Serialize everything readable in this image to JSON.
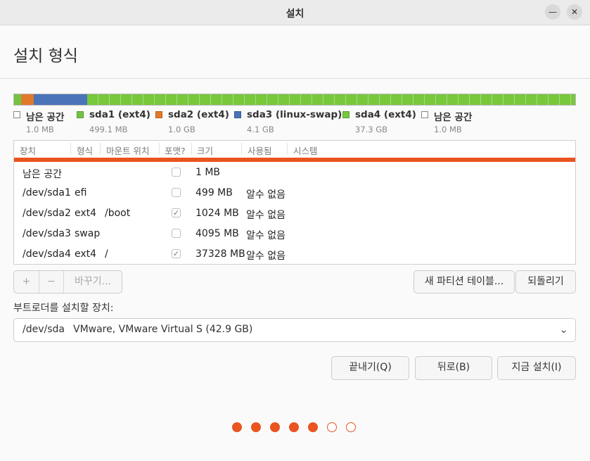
{
  "window": {
    "title": "설치",
    "min_glyph": "—",
    "close_glyph": "✕"
  },
  "page": {
    "heading": "설치 형식"
  },
  "disk_bar": {
    "segments": [
      {
        "name": "남은 공간",
        "share": 0.0002,
        "kind": "free"
      },
      {
        "name": "sda1 (ext4)",
        "share": 0.012,
        "kind": "p1"
      },
      {
        "name": "sda2 (ext4)",
        "share": 0.023,
        "kind": "p2"
      },
      {
        "name": "sda3 (linux-swap)",
        "share": 0.095,
        "kind": "p3"
      },
      {
        "name": "sda4 (ext4)",
        "share": 0.87,
        "kind": "p4"
      }
    ]
  },
  "legend": [
    {
      "name": "남은 공간",
      "size": "1.0 MB",
      "color": "#ffffff"
    },
    {
      "name": "sda1 (ext4)",
      "size": "499.1 MB",
      "color": "#73c244"
    },
    {
      "name": "sda2 (ext4)",
      "size": "1.0 GB",
      "color": "#e07a2a"
    },
    {
      "name": "sda3 (linux-swap)",
      "size": "4.1 GB",
      "color": "#4a73b8"
    },
    {
      "name": "sda4 (ext4)",
      "size": "37.3 GB",
      "color": "#78c83c"
    },
    {
      "name": "남은 공간",
      "size": "1.0 MB",
      "color": "#ffffff"
    }
  ],
  "table": {
    "headers": {
      "device": "장치",
      "type": "형식",
      "mount": "마운트 위치",
      "format": "포맷?",
      "size": "크기",
      "used": "사용됨",
      "system": "시스템"
    },
    "rows": [
      {
        "device": "남은 공간",
        "type": "",
        "mount": "",
        "format": false,
        "size": "1 MB",
        "used": ""
      },
      {
        "device": "/dev/sda1",
        "type": "efi",
        "mount": "",
        "format": false,
        "size": "499 MB",
        "used": "알수 없음"
      },
      {
        "device": "/dev/sda2",
        "type": "ext4",
        "mount": "/boot",
        "format": true,
        "size": "1024 MB",
        "used": "알수 없음"
      },
      {
        "device": "/dev/sda3",
        "type": "swap",
        "mount": "",
        "format": false,
        "size": "4095 MB",
        "used": "알수 없음"
      },
      {
        "device": "/dev/sda4",
        "type": "ext4",
        "mount": "/",
        "format": true,
        "size": "37328 MB",
        "used": "알수 없음"
      }
    ]
  },
  "controls": {
    "add": "+",
    "remove": "−",
    "change": "바꾸기...",
    "new_table": "새 파티션 테이블...",
    "revert": "되돌리기"
  },
  "bootloader": {
    "label": "부트로더를 설치할 장치:",
    "device": "/dev/sda",
    "model": "VMware, VMware Virtual S (42.9 GB)"
  },
  "actions": {
    "quit": "끝내기(Q)",
    "back": "뒤로(B)",
    "install_now": "지금 설치(I)"
  },
  "progress": {
    "current_step": 5,
    "total_steps": 7
  },
  "colors": {
    "accent": "#e95420"
  }
}
